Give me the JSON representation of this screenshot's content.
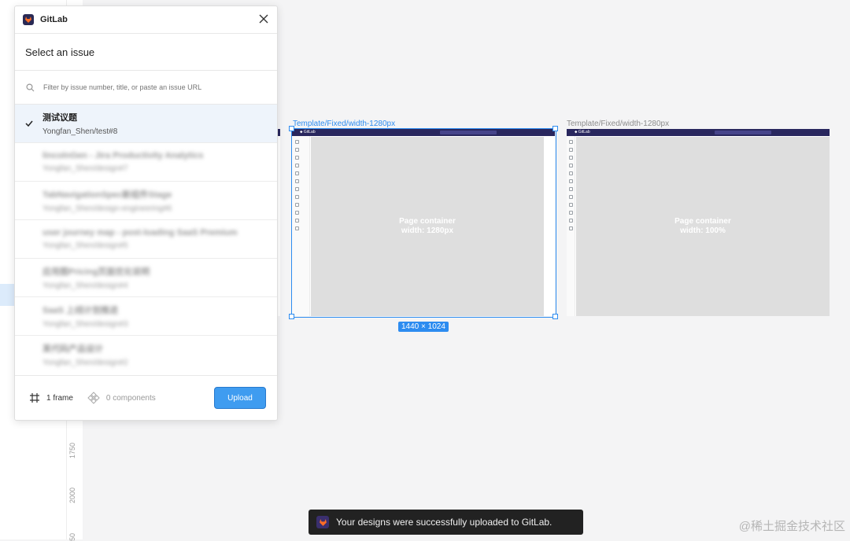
{
  "colors": {
    "accent": "#2d8cf0",
    "gitlab_purple": "#29275e",
    "toast_bg": "#222222"
  },
  "ruler": {
    "marks": [
      "1750",
      "2000",
      "50"
    ]
  },
  "canvas": {
    "frame1": {
      "label": "Template/Fixed/width-1280px",
      "container_title": "Page container",
      "container_sub": "width: 1280px",
      "size": "1440 × 1024"
    },
    "frame2": {
      "label": "Template/Fixed/width-1280px",
      "container_title": "Page container",
      "container_sub": "width: 100%"
    }
  },
  "panel": {
    "app_name": "GitLab",
    "title": "Select an issue",
    "filter_placeholder": "Filter by issue number, title, or paste an issue URL",
    "issues": [
      {
        "title": "测试议题",
        "ref": "Yongfan_Shen/test#8",
        "selected": true
      },
      {
        "title": "lincolnGen - Jira Productivity Analytics",
        "ref": "Yongfan_Shen/design#7",
        "selected": false
      },
      {
        "title": "TabNavigationSpec新组件Stage",
        "ref": "Yongfan_Shen/design-engineering#6",
        "selected": false
      },
      {
        "title": "user journey map - post-loading SaaS Premium",
        "ref": "Yongfan_Shen/design#5",
        "selected": false
      },
      {
        "title": "应用图Pricing页面优化说明",
        "ref": "Yongfan_Shen/design#4",
        "selected": false
      },
      {
        "title": "SaaS 上线计划推进",
        "ref": "Yongfan_Shen/design#3",
        "selected": false
      },
      {
        "title": "某代码产品设计",
        "ref": "Yongfan_Shen/design#2",
        "selected": false
      }
    ],
    "footer": {
      "frames": "1 frame",
      "components": "0 components",
      "upload_label": "Upload"
    }
  },
  "toast": {
    "message": "Your designs were successfully uploaded to GitLab."
  },
  "watermark": "@稀土掘金技术社区"
}
